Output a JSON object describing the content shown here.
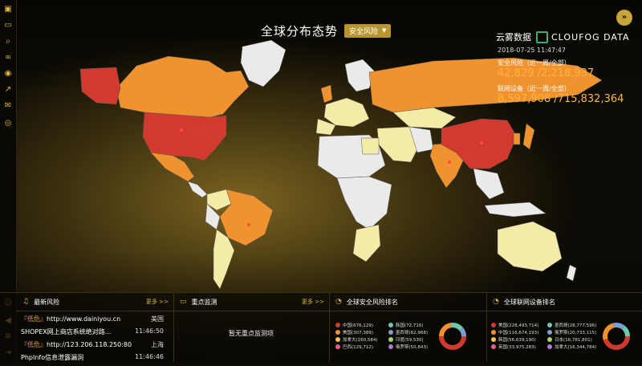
{
  "header": {
    "title": "全球分布态势",
    "filter_label": "安全风险",
    "logo_cn": "云雾数据",
    "logo_en": "CLOUFOG DATA"
  },
  "stats": {
    "timestamp": "2018-07-25 11:47:47",
    "risk_label": "安全风险（近一周/全部）",
    "risk_value": "42,829 /2,218,937",
    "devices_label": "联网设备（近一周/全部）",
    "devices_value": "8,597,908 /715,832,364"
  },
  "sidebar_icons": [
    "dashboard-icon",
    "monitor-icon",
    "search-icon",
    "binoculars-icon",
    "eye-icon",
    "trend-icon",
    "mail-icon",
    "globe-icon",
    "user-icon",
    "speaker-icon",
    "settings-icon",
    "logout-icon"
  ],
  "panels": {
    "latest_risk": {
      "title": "最新风险",
      "more": "更多 >>",
      "items": [
        {
          "tag": "『低危』",
          "url": "http://www.dainiyou.cn",
          "region": "美国",
          "desc": "SHOPEX网上商店系统绝对路...",
          "time": "11:46:50"
        },
        {
          "tag": "『低危』",
          "url": "http://123.206.118.250:80",
          "region": "上海",
          "desc": "PhpInfo信息泄露漏洞",
          "time": "11:46:46"
        }
      ]
    },
    "key_monitor": {
      "title": "重点监测",
      "more": "更多 >>",
      "empty": "暂无重点监测项"
    },
    "risk_rank": {
      "title": "全球安全风险排名",
      "col1": [
        "中国(676,129)",
        "美国(307,389)",
        "加拿大(160,584)",
        "巴西(129,712)"
      ],
      "col2": [
        "韩国(72,716)",
        "墨西哥(62,968)",
        "印度(59,530)",
        "俄罗斯(50,843)"
      ]
    },
    "device_rank": {
      "title": "全球联网设备排名",
      "col1": [
        "美国(228,493,714)",
        "中国(116,674,193)",
        "韩国(56,639,190)",
        "英国(33,975,283)"
      ],
      "col2": [
        "墨西哥(28,777,596)",
        "俄罗斯(20,733,115)",
        "日本(16,781,801)",
        "加拿大(16,344,784)"
      ]
    }
  },
  "colors": {
    "accent": "#d8b740",
    "highest": "#d23a2e",
    "high": "#f0922e",
    "medium": "#f4eba8",
    "none": "#eaeaea"
  }
}
